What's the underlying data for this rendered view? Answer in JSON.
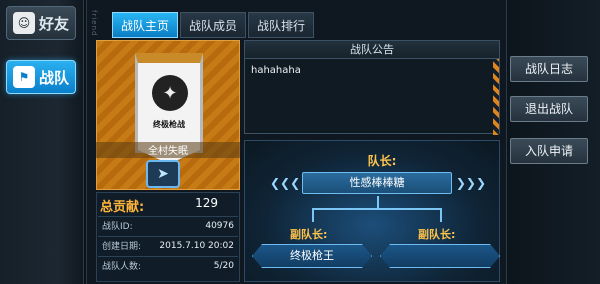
{
  "side": {
    "friends_label": "好友",
    "team_label": "战队"
  },
  "vertical_label": "friend",
  "tabs": [
    {
      "label": "战队主页",
      "active": true
    },
    {
      "label": "战队成员",
      "active": false
    },
    {
      "label": "战队排行",
      "active": false
    }
  ],
  "emblem": {
    "banner_text": "终极枪战",
    "team_name": "全村失眠"
  },
  "stats": {
    "contribution_label": "总贡献:",
    "contribution_value": "129",
    "rows": [
      {
        "key": "战队ID:",
        "value": "40976"
      },
      {
        "key": "创建日期:",
        "value": "2015.7.10 20:02"
      },
      {
        "key": "战队人数:",
        "value": "5/20"
      }
    ]
  },
  "announcement": {
    "title": "战队公告",
    "body": "hahahaha"
  },
  "hierarchy": {
    "leader_label": "队长:",
    "leader_name": "性感棒棒糖",
    "deputies": [
      {
        "label": "副队长:",
        "name": "终极枪王"
      },
      {
        "label": "副队长:",
        "name": ""
      }
    ]
  },
  "buttons": {
    "log": "战队日志",
    "quit": "退出战队",
    "apply": "入队申请"
  },
  "colors": {
    "accent_blue": "#0a7dc4",
    "gold": "#ffc34a",
    "emblem_orange": "#c77b16"
  }
}
